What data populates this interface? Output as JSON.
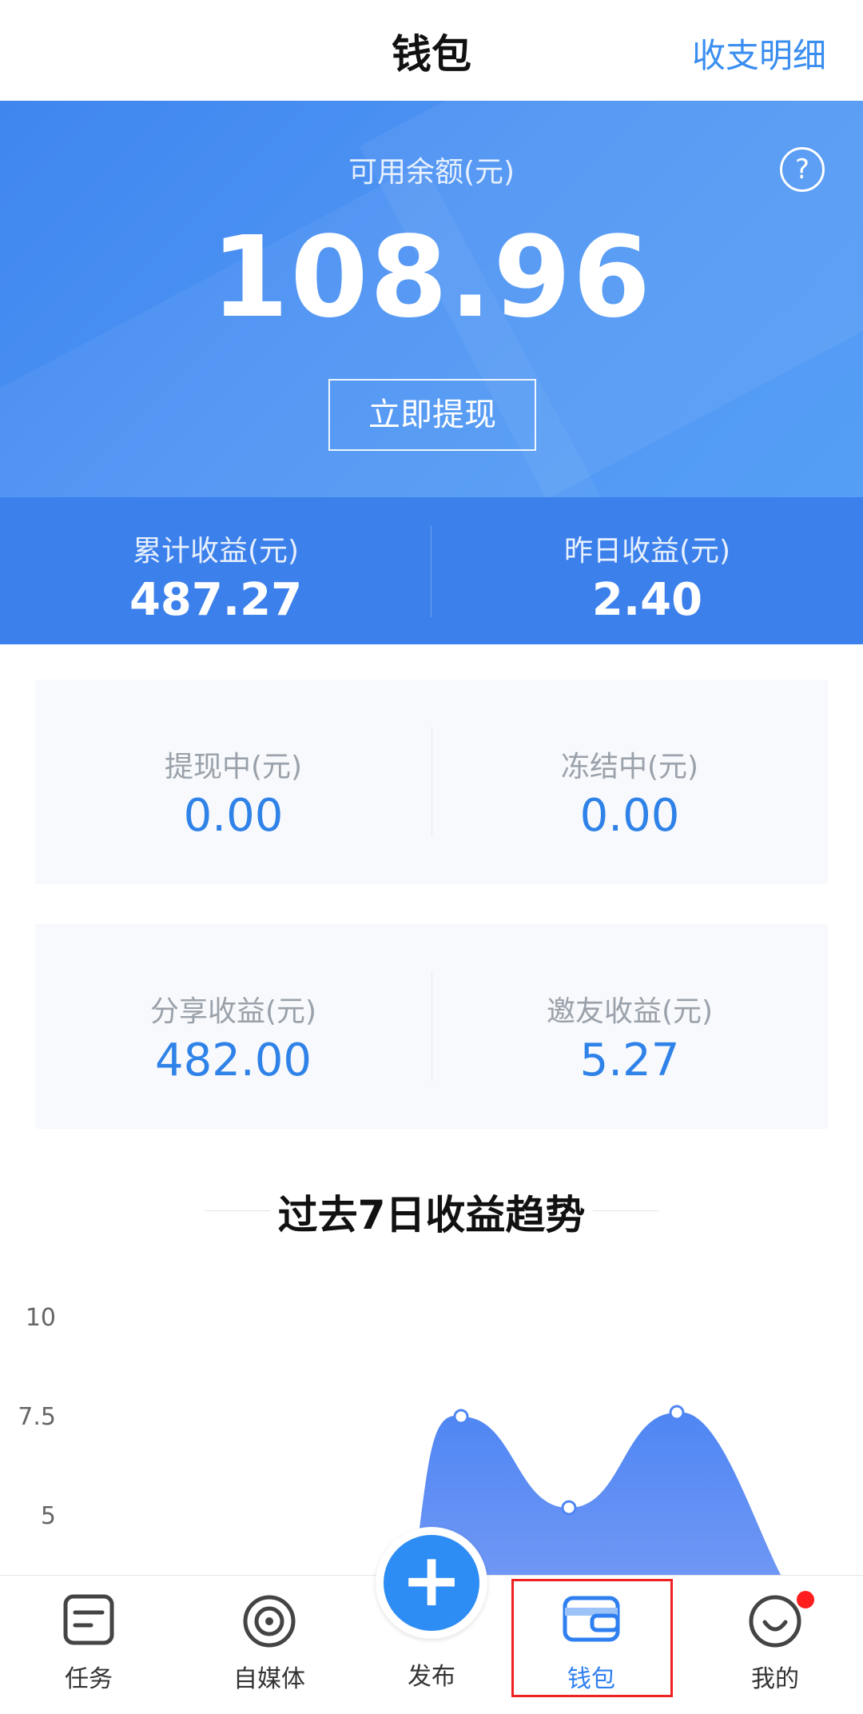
{
  "header": {
    "title": "钱包",
    "detail_link": "收支明细"
  },
  "balance": {
    "label": "可用余额(元)",
    "amount": "108.96",
    "withdraw_button": "立即提现",
    "help_icon": "question-circle-icon"
  },
  "summary": {
    "total": {
      "label": "累计收益(元)",
      "value": "487.27"
    },
    "yesterday": {
      "label": "昨日收益(元)",
      "value": "2.40"
    }
  },
  "cards": [
    {
      "left": {
        "label": "提现中(元)",
        "value": "0.00"
      },
      "right": {
        "label": "冻结中(元)",
        "value": "0.00"
      }
    },
    {
      "left": {
        "label": "分享收益(元)",
        "value": "482.00"
      },
      "right": {
        "label": "邀友收益(元)",
        "value": "5.27"
      }
    }
  ],
  "chart_data": {
    "type": "area",
    "title": "过去7日收益趋势",
    "y_ticks": [
      "10",
      "7.5",
      "5"
    ],
    "ylim": [
      0,
      10
    ],
    "points": [
      {
        "x": 3,
        "y": 7.5
      },
      {
        "x": 4,
        "y": 5.2
      },
      {
        "x": 5,
        "y": 7.6
      }
    ],
    "fill_color": "#4f86f3"
  },
  "tabbar": {
    "tabs": [
      {
        "label": "任务",
        "icon": "task-list-icon"
      },
      {
        "label": "自媒体",
        "icon": "target-circle-icon"
      },
      {
        "label": "发布",
        "icon": "plus-icon"
      },
      {
        "label": "钱包",
        "icon": "wallet-icon",
        "active": true
      },
      {
        "label": "我的",
        "icon": "smile-face-icon",
        "has_badge": true
      }
    ]
  }
}
